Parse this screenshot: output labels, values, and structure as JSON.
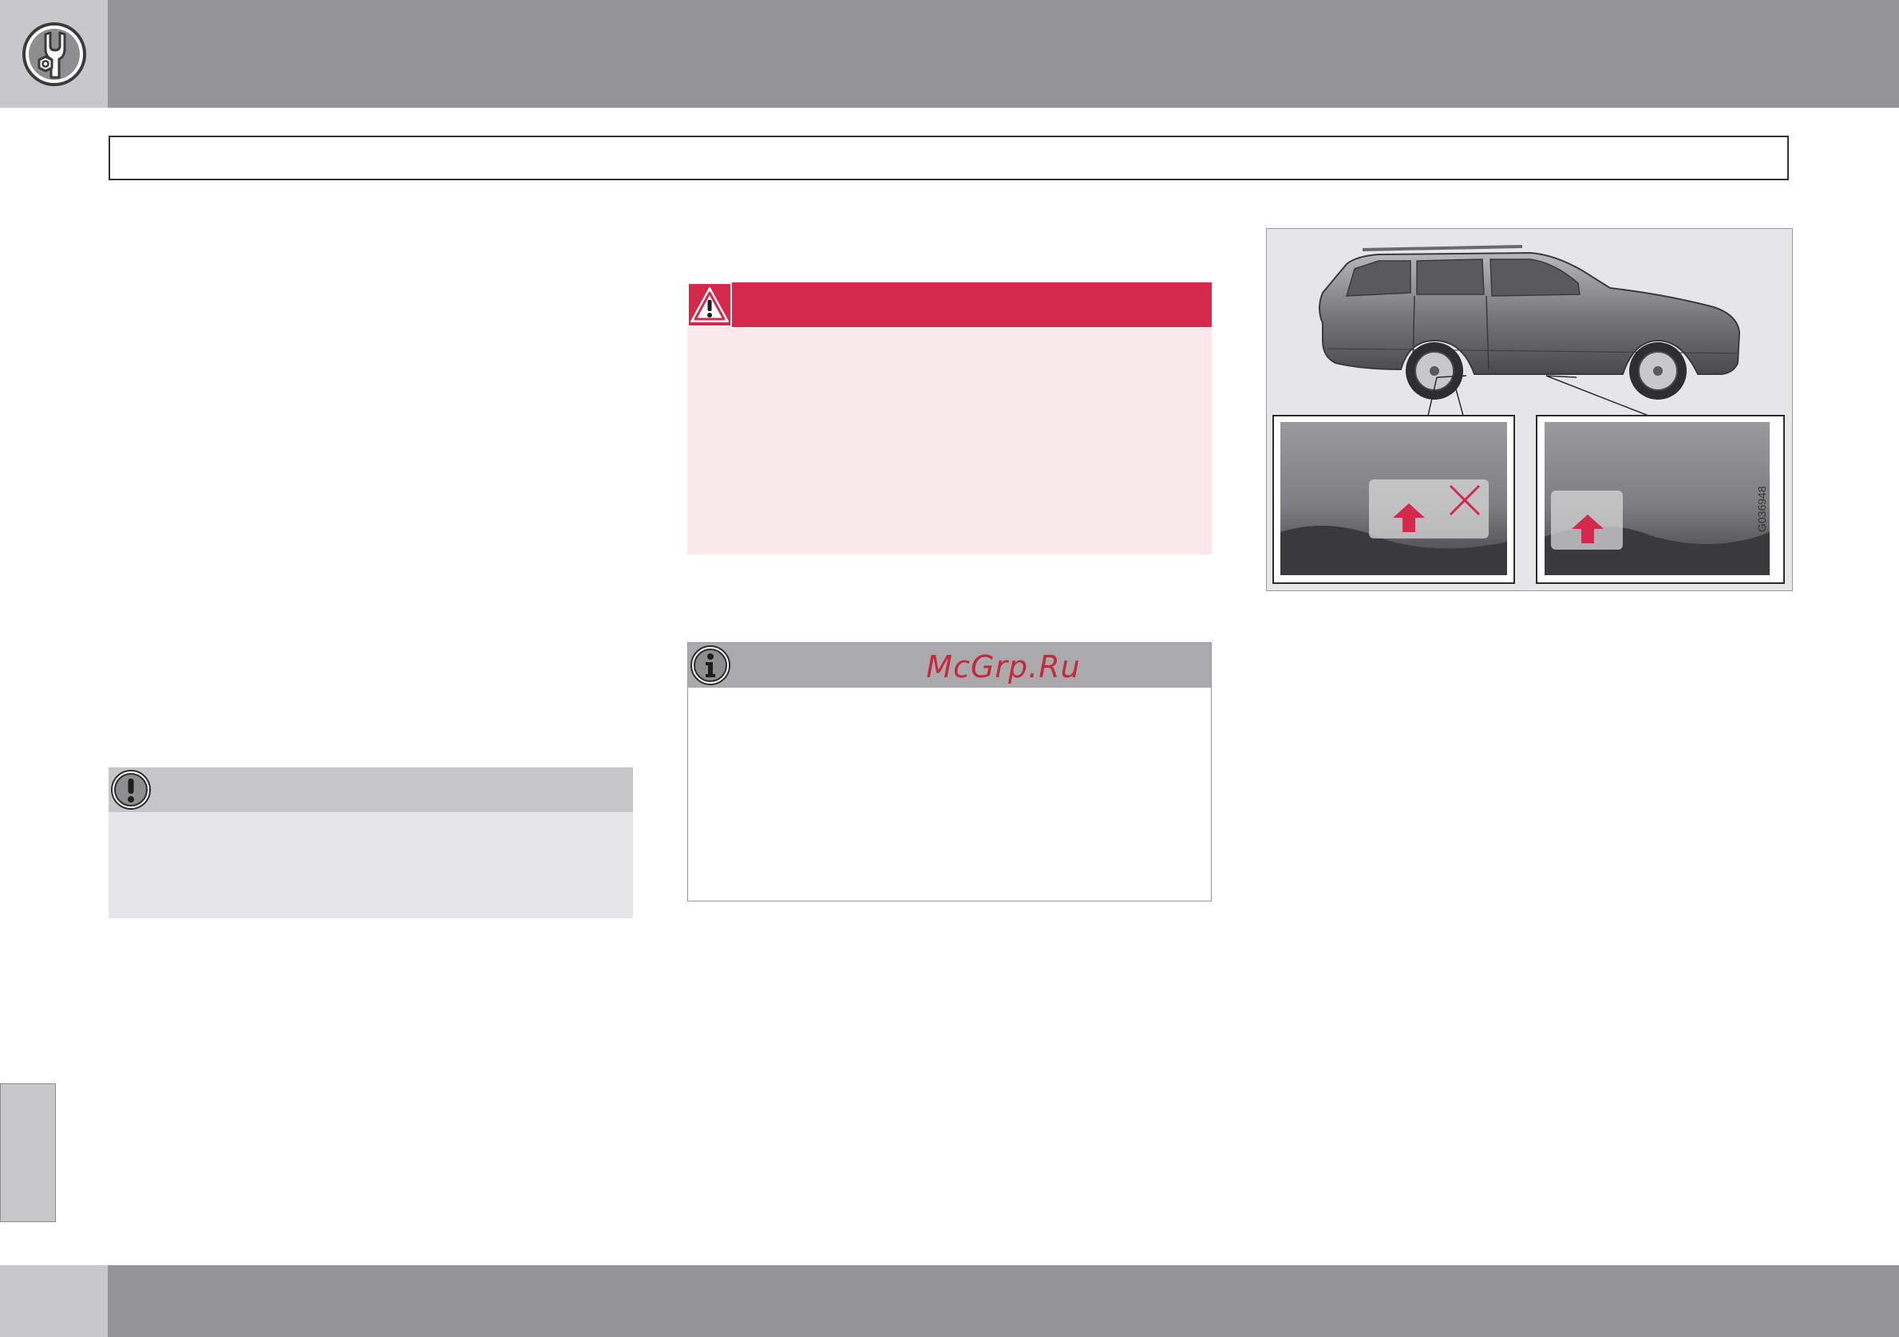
{
  "header": {
    "icon": "wrench-service-icon",
    "title": ""
  },
  "boxes": {
    "important": {
      "icon": "exclamation-icon",
      "color": "#c6c6c8"
    },
    "warning": {
      "icon": "warning-triangle-icon",
      "color": "#d5294c"
    },
    "note": {
      "icon": "info-icon",
      "color": "#aaaaac",
      "watermark": "McGrp.Ru"
    }
  },
  "figure": {
    "code": "G036948",
    "left_detail_marks": [
      "arrow-up-icon",
      "cross-icon"
    ],
    "right_detail_marks": [
      "arrow-up-icon"
    ],
    "accent_color": "#d5294c"
  }
}
